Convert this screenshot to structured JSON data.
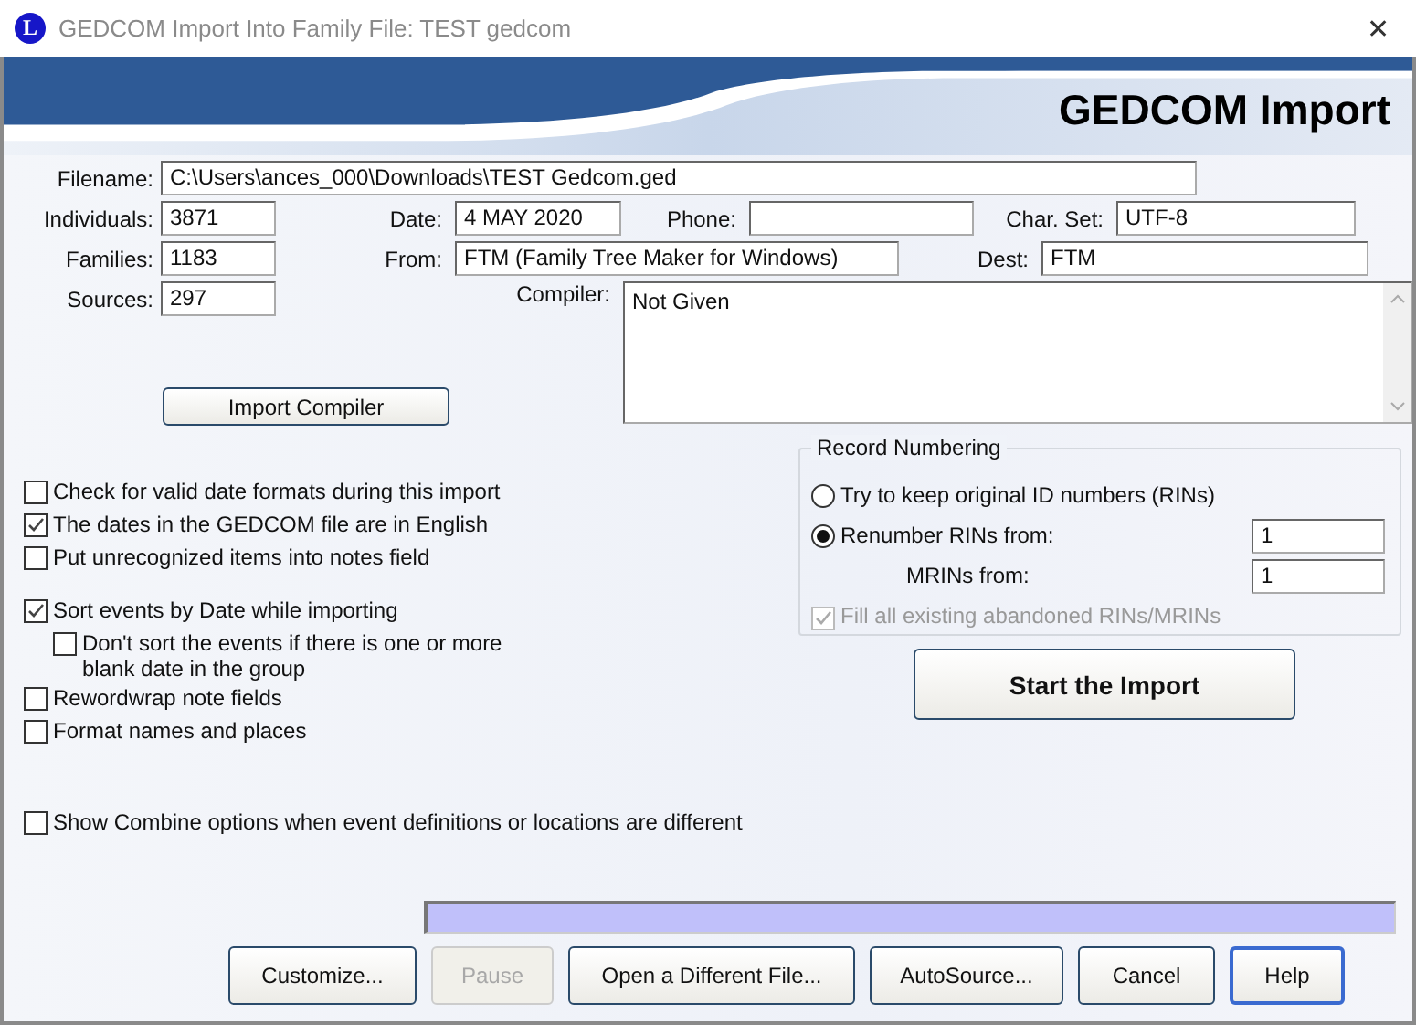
{
  "window": {
    "logo": "L",
    "title": "GEDCOM Import Into Family File: TEST gedcom",
    "close": "✕"
  },
  "header": {
    "title": "GEDCOM Import"
  },
  "file_info": {
    "filename": {
      "label": "Filename:",
      "value": "C:\\Users\\ances_000\\Downloads\\TEST Gedcom.ged"
    },
    "individuals": {
      "label": "Individuals:",
      "value": "3871"
    },
    "date": {
      "label": "Date:",
      "value": "4 MAY 2020"
    },
    "phone": {
      "label": "Phone:"
    },
    "char_set": {
      "label": "Char. Set:",
      "value": "UTF-8"
    },
    "families": {
      "label": "Families:",
      "value": "1183"
    },
    "from": {
      "label": "From:",
      "value": "FTM (Family Tree Maker for Windows)"
    },
    "dest": {
      "label": "Dest:",
      "value": "FTM"
    },
    "sources": {
      "label": "Sources:",
      "value": "297"
    },
    "compiler": {
      "label": "Compiler:",
      "value": "Not Given"
    }
  },
  "import_compiler_button": "Import Compiler",
  "option_groups": [
    {
      "options": [
        {
          "label": "Check for valid date formats during this import",
          "checked": false
        },
        {
          "label": "The dates in the GEDCOM file are in English",
          "checked": true
        },
        {
          "label": "Put unrecognized items into notes field",
          "checked": false
        }
      ]
    },
    {
      "options": [
        {
          "label": "Sort events by Date while importing",
          "checked": true,
          "children": [
            {
              "label": "Don't sort the events if there is one or more blank date in the group",
              "checked": false
            }
          ]
        },
        {
          "label": "Rewordwrap note fields",
          "checked": false
        },
        {
          "label": "Format names and places",
          "checked": false
        }
      ]
    },
    {
      "options": [
        {
          "label": "Show Combine options when event definitions or locations are different",
          "checked": false
        }
      ]
    }
  ],
  "record_numbering": {
    "title": "Record Numbering",
    "choices": [
      {
        "label": "Try to keep original ID numbers (RINs)",
        "selected": false
      },
      {
        "label": "Renumber RINs from:",
        "selected": true,
        "value": "1"
      }
    ],
    "mrins": {
      "label": "MRINs from:",
      "value": "1"
    },
    "fill_all": {
      "label": "Fill all existing abandoned RINs/MRINs",
      "checked": true,
      "disabled": true
    }
  },
  "start_button": "Start the Import",
  "progress": {
    "level": 1
  },
  "buttons": [
    {
      "label": "Customize...",
      "disabled": false,
      "default": false
    },
    {
      "label": "Pause",
      "disabled": true,
      "default": false
    },
    {
      "label": "Open a Different File...",
      "disabled": false,
      "default": false
    },
    {
      "label": "AutoSource...",
      "disabled": false,
      "default": false
    },
    {
      "label": "Cancel",
      "disabled": false,
      "default": false
    },
    {
      "label": "Help",
      "disabled": false,
      "default": true
    }
  ]
}
